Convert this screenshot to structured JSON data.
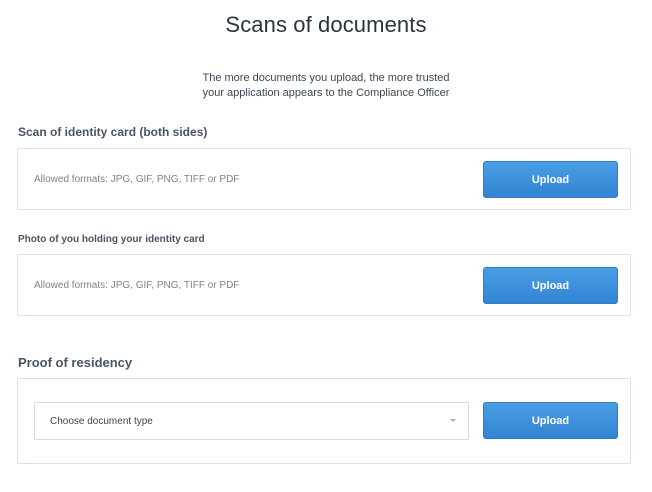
{
  "page": {
    "title": "Scans of documents",
    "subtitle_line1": "The more documents you upload, the more trusted",
    "subtitle_line2": "your application appears to the Compliance Officer"
  },
  "sections": [
    {
      "label": "Scan of identity card (both sides)",
      "formats_text": "Allowed formats: JPG, GIF, PNG, TIFF or PDF",
      "button_label": "Upload"
    },
    {
      "label": "Photo of you holding your identity card",
      "formats_text": "Allowed formats: JPG, GIF, PNG, TIFF or PDF",
      "button_label": "Upload"
    },
    {
      "label": "Proof of residency",
      "select_value": "Choose document type",
      "button_label": "Upload"
    }
  ],
  "colors": {
    "primary_button": "#3a8fdc",
    "border": "#dde0e4",
    "heading_text": "#2a3440"
  },
  "icons": {
    "select_caret": "chevron-down-icon"
  }
}
